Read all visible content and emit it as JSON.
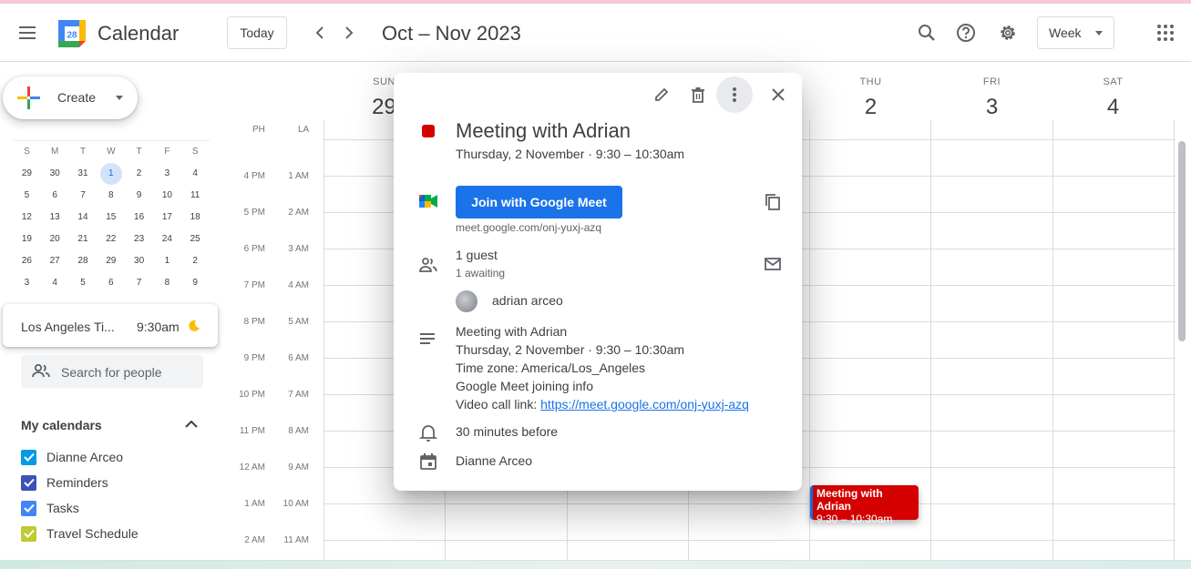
{
  "header": {
    "app_title": "Calendar",
    "logo_day": "28",
    "today_label": "Today",
    "date_range": "Oct – Nov 2023",
    "view_label": "Week"
  },
  "sidebar": {
    "create_label": "Create",
    "mini_cal": {
      "weekdays": [
        "S",
        "M",
        "T",
        "W",
        "T",
        "F",
        "S"
      ],
      "weeks": [
        [
          "29",
          "30",
          "31",
          "1",
          "2",
          "3",
          "4"
        ],
        [
          "5",
          "6",
          "7",
          "8",
          "9",
          "10",
          "11"
        ],
        [
          "12",
          "13",
          "14",
          "15",
          "16",
          "17",
          "18"
        ],
        [
          "19",
          "20",
          "21",
          "22",
          "23",
          "24",
          "25"
        ],
        [
          "26",
          "27",
          "28",
          "29",
          "30",
          "1",
          "2"
        ],
        [
          "3",
          "4",
          "5",
          "6",
          "7",
          "8",
          "9"
        ]
      ],
      "selected": "1"
    },
    "world_clock": {
      "city": "Los Angeles Ti...",
      "time": "9:30am"
    },
    "search_people_placeholder": "Search for people",
    "my_calendars_heading": "My calendars",
    "calendars": [
      {
        "name": "Dianne Arceo",
        "color": "#039be5"
      },
      {
        "name": "Reminders",
        "color": "#3f51b5"
      },
      {
        "name": "Tasks",
        "color": "#4285f4"
      },
      {
        "name": "Travel Schedule",
        "color": "#c0ca33"
      }
    ]
  },
  "grid": {
    "days": [
      {
        "dow": "SUN",
        "num": "29"
      },
      {
        "dow": "THU",
        "num": "2"
      },
      {
        "dow": "FRI",
        "num": "3"
      },
      {
        "dow": "SAT",
        "num": "4"
      }
    ],
    "tz_primary": "PH",
    "tz_secondary": "LA",
    "times": [
      {
        "ph": "4 PM",
        "la": "1 AM"
      },
      {
        "ph": "5 PM",
        "la": "2 AM"
      },
      {
        "ph": "6 PM",
        "la": "3 AM"
      },
      {
        "ph": "7 PM",
        "la": "4 AM"
      },
      {
        "ph": "8 PM",
        "la": "5 AM"
      },
      {
        "ph": "9 PM",
        "la": "6 AM"
      },
      {
        "ph": "10 PM",
        "la": "7 AM"
      },
      {
        "ph": "11 PM",
        "la": "8 AM"
      },
      {
        "ph": "12 AM",
        "la": "9 AM"
      },
      {
        "ph": "1 AM",
        "la": "10 AM"
      },
      {
        "ph": "2 AM",
        "la": "11 AM"
      }
    ],
    "event": {
      "title": "Meeting with Adrian",
      "time": "9:30 – 10:30am",
      "color": "#d50000"
    }
  },
  "popup": {
    "title": "Meeting with Adrian",
    "date_line": "Thursday, 2 November  ·  9:30 – 10:30am",
    "join_label": "Join with Google Meet",
    "meet_url": "meet.google.com/onj-yuxj-azq",
    "guest_count": "1 guest",
    "guest_awaiting": "1 awaiting",
    "guest_name": "adrian arceo",
    "description": {
      "line1": "Meeting with Adrian",
      "line2": "Thursday, 2 November · 9:30 – 10:30am",
      "line3": "Time zone: America/Los_Angeles",
      "line4": "Google Meet joining info",
      "line5_prefix": "Video call link: ",
      "line5_link": "https://meet.google.com/onj-yuxj-azq"
    },
    "reminder": "30 minutes before",
    "owner": "Dianne Arceo"
  }
}
